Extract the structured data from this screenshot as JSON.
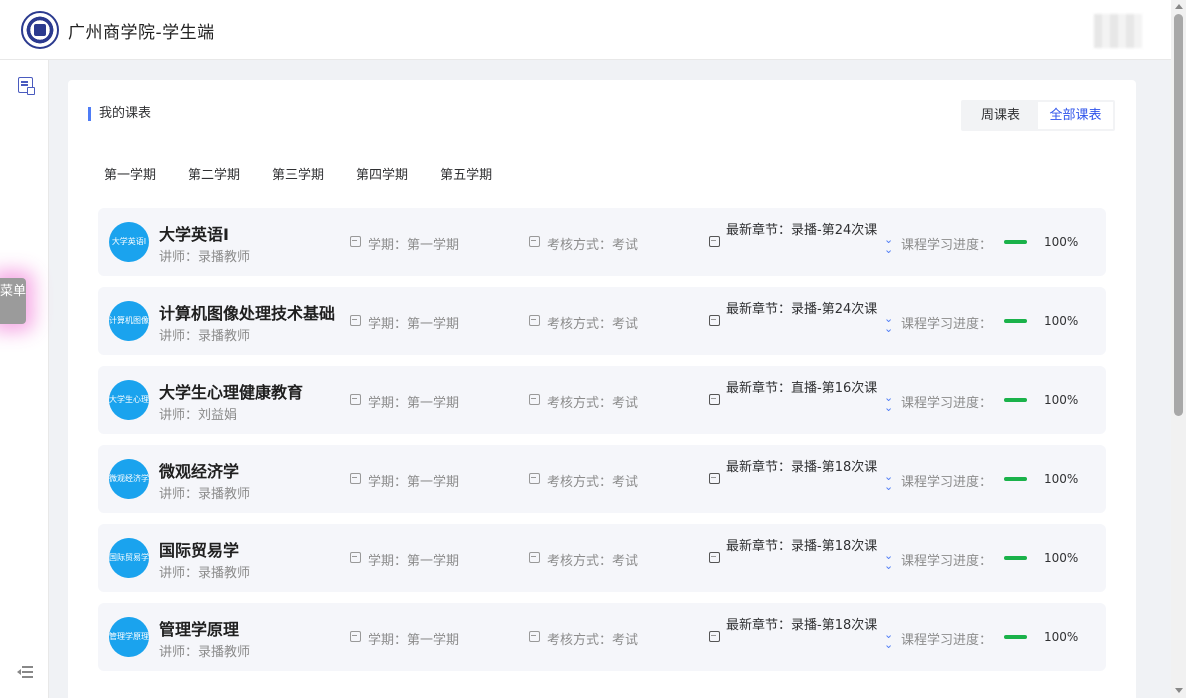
{
  "header": {
    "title": "广州商学院-学生端"
  },
  "sidebar": {
    "menu_tab_label": "菜单"
  },
  "main": {
    "section_title": "我的课表",
    "view_options": [
      "周课表",
      "全部课表"
    ],
    "active_view": "全部课表",
    "semesters": [
      "第一学期",
      "第二学期",
      "第三学期",
      "第四学期",
      "第五学期"
    ],
    "courses": [
      {
        "name": "大学英语I",
        "logo_text": "大学英语I",
        "teacher": "讲师：录播教师",
        "term": "学期：第一学期",
        "exam": "考核方式：考试",
        "chapter": "最新章节：录播-第24次课",
        "progress_label": "课程学习进度：",
        "progress": 100,
        "progress_text": "100%"
      },
      {
        "name": "计算机图像处理技术基础",
        "logo_text": "计算机图像处理技术基础",
        "teacher": "讲师：录播教师",
        "term": "学期：第一学期",
        "exam": "考核方式：考试",
        "chapter": "最新章节：录播-第24次课",
        "progress_label": "课程学习进度：",
        "progress": 100,
        "progress_text": "100%"
      },
      {
        "name": "大学生心理健康教育",
        "logo_text": "大学生心理健康教育",
        "teacher": "讲师：刘益娟",
        "term": "学期：第一学期",
        "exam": "考核方式：考试",
        "chapter": "最新章节：直播-第16次课",
        "progress_label": "课程学习进度：",
        "progress": 100,
        "progress_text": "100%"
      },
      {
        "name": "微观经济学",
        "logo_text": "微观经济学",
        "teacher": "讲师：录播教师",
        "term": "学期：第一学期",
        "exam": "考核方式：考试",
        "chapter": "最新章节：录播-第18次课",
        "progress_label": "课程学习进度：",
        "progress": 100,
        "progress_text": "100%"
      },
      {
        "name": "国际贸易学",
        "logo_text": "国际贸易学",
        "teacher": "讲师：录播教师",
        "term": "学期：第一学期",
        "exam": "考核方式：考试",
        "chapter": "最新章节：录播-第18次课",
        "progress_label": "课程学习进度：",
        "progress": 100,
        "progress_text": "100%"
      },
      {
        "name": "管理学原理",
        "logo_text": "管理学原理",
        "teacher": "讲师：录播教师",
        "term": "学期：第一学期",
        "exam": "考核方式：考试",
        "chapter": "最新章节：录播-第18次课",
        "progress_label": "课程学习进度：",
        "progress": 100,
        "progress_text": "100%"
      }
    ]
  },
  "icons": {
    "sidebar_top": "schedule-icon",
    "sidebar_bottom": "collapse-menu-icon",
    "term": "calendar-icon",
    "exam": "calendar-icon",
    "chapter": "document-icon",
    "progress": "double-chevron-down-icon"
  },
  "colors": {
    "accent": "#2f54eb",
    "course_logo": "#1aa3ee",
    "progress": "#1ab24a"
  }
}
